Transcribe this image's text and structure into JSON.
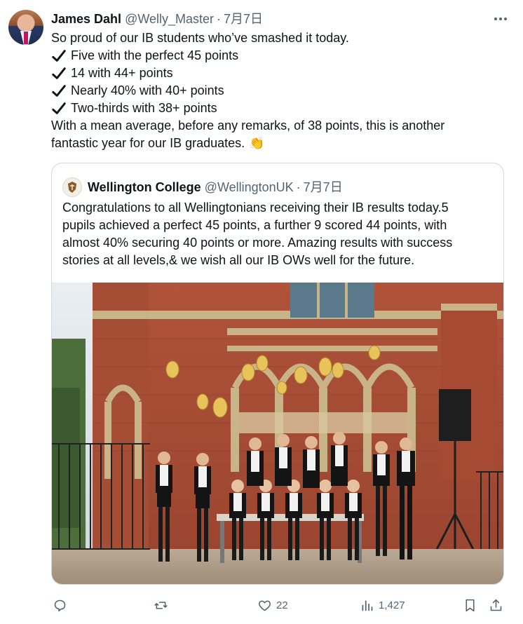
{
  "tweet": {
    "author": {
      "name": "James Dahl",
      "handle": "@Welly_Master",
      "separator": "·",
      "date": "7月7日"
    },
    "lines": [
      "So proud of our IB students who’ve smashed it today.",
      "Five with the perfect 45 points",
      "14 with 44+ points",
      "Nearly 40% with 40+ points",
      "Two-thirds with 38+ points",
      "With a mean average, before any remarks, of 38 points, this is another",
      "fantastic year for our IB graduates."
    ],
    "emoji": "👏"
  },
  "quoted": {
    "author": {
      "name": "Wellington College",
      "handle": "@WellingtonUK",
      "separator": "·",
      "date": "7月7日"
    },
    "lines": [
      "Congratulations to all Wellingtonians receiving their IB results today.5",
      "pupils achieved a perfect 45 points, a further 9 scored 44 points, with",
      "almost 40% securing 40 points or more. Amazing results with success",
      "stories at all levels,& we wish all our IB OWs well for the future."
    ]
  },
  "actions": {
    "reply": {
      "icon": "reply-icon"
    },
    "retweet": {
      "icon": "retweet-icon"
    },
    "like": {
      "icon": "heart-icon",
      "count": "22"
    },
    "views": {
      "icon": "views-icon",
      "count": "1,427"
    },
    "bookmark": {
      "icon": "bookmark-icon"
    },
    "share": {
      "icon": "share-icon"
    }
  },
  "colors": {
    "text": "#0f1419",
    "muted": "#536471",
    "border": "#cfd9de",
    "check": "#0f1419"
  }
}
